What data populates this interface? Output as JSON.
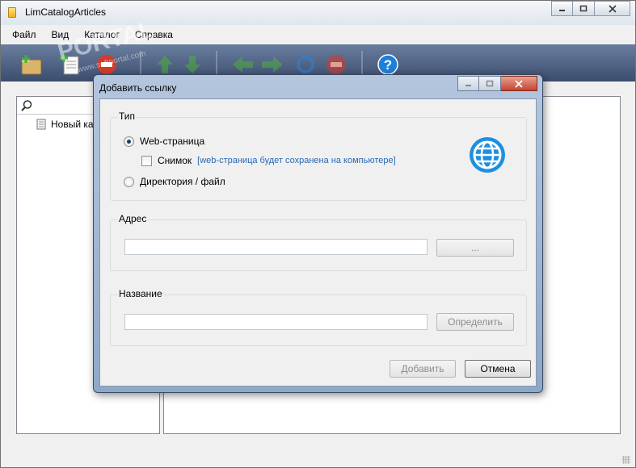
{
  "window": {
    "title": "LimCatalogArticles"
  },
  "menu": {
    "items": [
      "Файл",
      "Вид",
      "Каталог",
      "Справка"
    ]
  },
  "watermark": {
    "text": "PORTAL",
    "sub": "www.softportal.com"
  },
  "toolbar": {
    "icons": [
      "add-catalog-icon",
      "add-article-icon",
      "delete-icon",
      "move-up-icon",
      "move-down-icon",
      "back-icon",
      "forward-icon",
      "refresh-icon",
      "stop-icon",
      "help-icon"
    ],
    "colors": {
      "up_down": "#4fae3a",
      "nav": "#4fae3a",
      "refresh": "#2f7fd6",
      "stop": "#d23b2b",
      "help": "#1e7fd8"
    }
  },
  "tree": {
    "items": [
      {
        "label": "Новый ка"
      }
    ]
  },
  "dialog": {
    "title": "Добавить ссылку",
    "type_group": {
      "label": "Тип",
      "web_page": "Web-страница",
      "snapshot": "Снимок",
      "snapshot_hint": "[web-страница будет сохранена на компьютере]",
      "dir_file": "Директория / файл"
    },
    "address_group": {
      "label": "Адрес",
      "value": "",
      "browse_label": "..."
    },
    "name_group": {
      "label": "Название",
      "value": "",
      "detect_label": "Определить"
    },
    "add_label": "Добавить",
    "cancel_label": "Отмена",
    "accent_color": "#1e8fe0"
  }
}
